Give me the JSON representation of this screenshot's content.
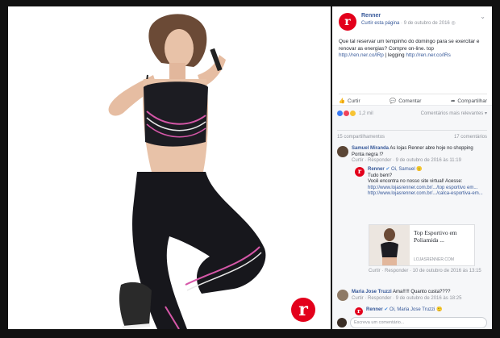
{
  "post": {
    "page_name": "Renner",
    "like_page": "Curtir esta página",
    "date": "9 de outubro de 2016",
    "separator": "·",
    "text_1": "Que tal reservar um tempinho do domingo para se exercitar e renovar as energias? Compre on-line. top",
    "link_1": "http://ren.ner.co/lRp",
    "text_2": "| legging",
    "link_2": "http://ren.ner.co/lRs"
  },
  "actions": {
    "like": "Curtir",
    "comment": "Comentar",
    "share": "Compartilhar"
  },
  "reactions": {
    "count": "1,2 mil",
    "sort": "Comentários mais relevantes",
    "shares": "15 compartilhamentos",
    "comments": "17 comentários"
  },
  "comments": [
    {
      "name": "Samuel Miranda",
      "text": "As lojas Renner abre hoje no shopping Ponta negra !?",
      "reply": "Curtir · Responder · 9 de outubro de 2016 às 11:19"
    },
    {
      "name": "Renner",
      "mention": "Oi, Samuel",
      "text_1": "Tudo bem?",
      "text_2": "Você encontra no nosso site virtual! Acesse:",
      "link_1": "http://www.lojasrenner.com.br/.../top esportivo em...",
      "link_2": "http://www.lojasrenner.com.br/.../calca-esportiva-em...",
      "card_title": "Top Esportivo em Poliamida ...",
      "card_domain": "LOJASRENNER.COM",
      "reply": "Curtir · Responder · 10 de outubro de 2016 às 13:15"
    },
    {
      "name": "Maria Jose Truzzi",
      "text": "Ama!!!!! Quanto custa????",
      "reply": "Curtir · Responder · 9 de outubro de 2016 às 18:25"
    },
    {
      "name": "Renner",
      "mention": "Oi, Maria Jose Truzzi"
    }
  ],
  "compose": {
    "placeholder": "Escreva um comentário..."
  },
  "brand_color": "#e3001b",
  "link_color": "#365899"
}
